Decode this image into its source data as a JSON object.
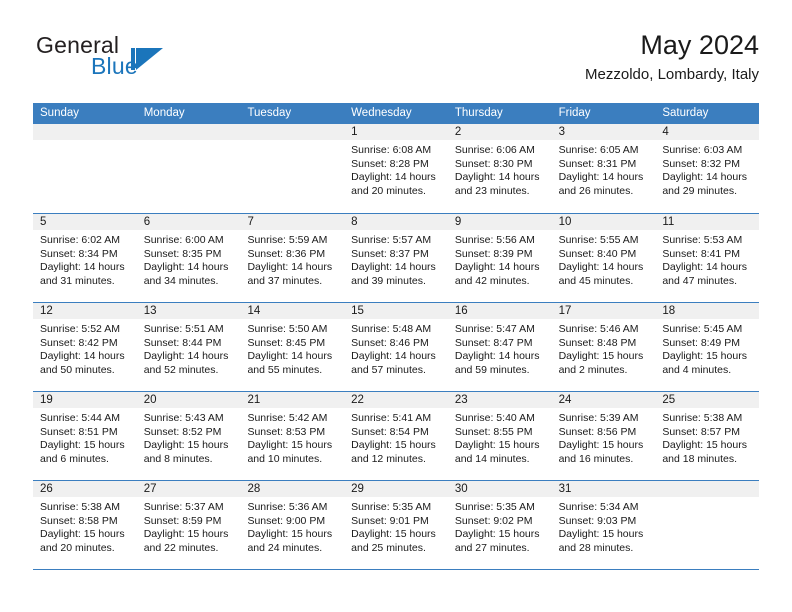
{
  "brand": {
    "name_part1": "General",
    "name_part2": "Blue",
    "accent_color": "#1b75bb"
  },
  "header": {
    "title": "May 2024",
    "subtitle": "Mezzoldo, Lombardy, Italy"
  },
  "calendar": {
    "header_color": "#3b7ebf",
    "weekday_headers": [
      "Sunday",
      "Monday",
      "Tuesday",
      "Wednesday",
      "Thursday",
      "Friday",
      "Saturday"
    ],
    "weeks": [
      [
        {
          "day": "",
          "sunrise": "",
          "sunset": "",
          "daylight_line1": "",
          "daylight_line2": ""
        },
        {
          "day": "",
          "sunrise": "",
          "sunset": "",
          "daylight_line1": "",
          "daylight_line2": ""
        },
        {
          "day": "",
          "sunrise": "",
          "sunset": "",
          "daylight_line1": "",
          "daylight_line2": ""
        },
        {
          "day": "1",
          "sunrise": "Sunrise: 6:08 AM",
          "sunset": "Sunset: 8:28 PM",
          "daylight_line1": "Daylight: 14 hours",
          "daylight_line2": "and 20 minutes."
        },
        {
          "day": "2",
          "sunrise": "Sunrise: 6:06 AM",
          "sunset": "Sunset: 8:30 PM",
          "daylight_line1": "Daylight: 14 hours",
          "daylight_line2": "and 23 minutes."
        },
        {
          "day": "3",
          "sunrise": "Sunrise: 6:05 AM",
          "sunset": "Sunset: 8:31 PM",
          "daylight_line1": "Daylight: 14 hours",
          "daylight_line2": "and 26 minutes."
        },
        {
          "day": "4",
          "sunrise": "Sunrise: 6:03 AM",
          "sunset": "Sunset: 8:32 PM",
          "daylight_line1": "Daylight: 14 hours",
          "daylight_line2": "and 29 minutes."
        }
      ],
      [
        {
          "day": "5",
          "sunrise": "Sunrise: 6:02 AM",
          "sunset": "Sunset: 8:34 PM",
          "daylight_line1": "Daylight: 14 hours",
          "daylight_line2": "and 31 minutes."
        },
        {
          "day": "6",
          "sunrise": "Sunrise: 6:00 AM",
          "sunset": "Sunset: 8:35 PM",
          "daylight_line1": "Daylight: 14 hours",
          "daylight_line2": "and 34 minutes."
        },
        {
          "day": "7",
          "sunrise": "Sunrise: 5:59 AM",
          "sunset": "Sunset: 8:36 PM",
          "daylight_line1": "Daylight: 14 hours",
          "daylight_line2": "and 37 minutes."
        },
        {
          "day": "8",
          "sunrise": "Sunrise: 5:57 AM",
          "sunset": "Sunset: 8:37 PM",
          "daylight_line1": "Daylight: 14 hours",
          "daylight_line2": "and 39 minutes."
        },
        {
          "day": "9",
          "sunrise": "Sunrise: 5:56 AM",
          "sunset": "Sunset: 8:39 PM",
          "daylight_line1": "Daylight: 14 hours",
          "daylight_line2": "and 42 minutes."
        },
        {
          "day": "10",
          "sunrise": "Sunrise: 5:55 AM",
          "sunset": "Sunset: 8:40 PM",
          "daylight_line1": "Daylight: 14 hours",
          "daylight_line2": "and 45 minutes."
        },
        {
          "day": "11",
          "sunrise": "Sunrise: 5:53 AM",
          "sunset": "Sunset: 8:41 PM",
          "daylight_line1": "Daylight: 14 hours",
          "daylight_line2": "and 47 minutes."
        }
      ],
      [
        {
          "day": "12",
          "sunrise": "Sunrise: 5:52 AM",
          "sunset": "Sunset: 8:42 PM",
          "daylight_line1": "Daylight: 14 hours",
          "daylight_line2": "and 50 minutes."
        },
        {
          "day": "13",
          "sunrise": "Sunrise: 5:51 AM",
          "sunset": "Sunset: 8:44 PM",
          "daylight_line1": "Daylight: 14 hours",
          "daylight_line2": "and 52 minutes."
        },
        {
          "day": "14",
          "sunrise": "Sunrise: 5:50 AM",
          "sunset": "Sunset: 8:45 PM",
          "daylight_line1": "Daylight: 14 hours",
          "daylight_line2": "and 55 minutes."
        },
        {
          "day": "15",
          "sunrise": "Sunrise: 5:48 AM",
          "sunset": "Sunset: 8:46 PM",
          "daylight_line1": "Daylight: 14 hours",
          "daylight_line2": "and 57 minutes."
        },
        {
          "day": "16",
          "sunrise": "Sunrise: 5:47 AM",
          "sunset": "Sunset: 8:47 PM",
          "daylight_line1": "Daylight: 14 hours",
          "daylight_line2": "and 59 minutes."
        },
        {
          "day": "17",
          "sunrise": "Sunrise: 5:46 AM",
          "sunset": "Sunset: 8:48 PM",
          "daylight_line1": "Daylight: 15 hours",
          "daylight_line2": "and 2 minutes."
        },
        {
          "day": "18",
          "sunrise": "Sunrise: 5:45 AM",
          "sunset": "Sunset: 8:49 PM",
          "daylight_line1": "Daylight: 15 hours",
          "daylight_line2": "and 4 minutes."
        }
      ],
      [
        {
          "day": "19",
          "sunrise": "Sunrise: 5:44 AM",
          "sunset": "Sunset: 8:51 PM",
          "daylight_line1": "Daylight: 15 hours",
          "daylight_line2": "and 6 minutes."
        },
        {
          "day": "20",
          "sunrise": "Sunrise: 5:43 AM",
          "sunset": "Sunset: 8:52 PM",
          "daylight_line1": "Daylight: 15 hours",
          "daylight_line2": "and 8 minutes."
        },
        {
          "day": "21",
          "sunrise": "Sunrise: 5:42 AM",
          "sunset": "Sunset: 8:53 PM",
          "daylight_line1": "Daylight: 15 hours",
          "daylight_line2": "and 10 minutes."
        },
        {
          "day": "22",
          "sunrise": "Sunrise: 5:41 AM",
          "sunset": "Sunset: 8:54 PM",
          "daylight_line1": "Daylight: 15 hours",
          "daylight_line2": "and 12 minutes."
        },
        {
          "day": "23",
          "sunrise": "Sunrise: 5:40 AM",
          "sunset": "Sunset: 8:55 PM",
          "daylight_line1": "Daylight: 15 hours",
          "daylight_line2": "and 14 minutes."
        },
        {
          "day": "24",
          "sunrise": "Sunrise: 5:39 AM",
          "sunset": "Sunset: 8:56 PM",
          "daylight_line1": "Daylight: 15 hours",
          "daylight_line2": "and 16 minutes."
        },
        {
          "day": "25",
          "sunrise": "Sunrise: 5:38 AM",
          "sunset": "Sunset: 8:57 PM",
          "daylight_line1": "Daylight: 15 hours",
          "daylight_line2": "and 18 minutes."
        }
      ],
      [
        {
          "day": "26",
          "sunrise": "Sunrise: 5:38 AM",
          "sunset": "Sunset: 8:58 PM",
          "daylight_line1": "Daylight: 15 hours",
          "daylight_line2": "and 20 minutes."
        },
        {
          "day": "27",
          "sunrise": "Sunrise: 5:37 AM",
          "sunset": "Sunset: 8:59 PM",
          "daylight_line1": "Daylight: 15 hours",
          "daylight_line2": "and 22 minutes."
        },
        {
          "day": "28",
          "sunrise": "Sunrise: 5:36 AM",
          "sunset": "Sunset: 9:00 PM",
          "daylight_line1": "Daylight: 15 hours",
          "daylight_line2": "and 24 minutes."
        },
        {
          "day": "29",
          "sunrise": "Sunrise: 5:35 AM",
          "sunset": "Sunset: 9:01 PM",
          "daylight_line1": "Daylight: 15 hours",
          "daylight_line2": "and 25 minutes."
        },
        {
          "day": "30",
          "sunrise": "Sunrise: 5:35 AM",
          "sunset": "Sunset: 9:02 PM",
          "daylight_line1": "Daylight: 15 hours",
          "daylight_line2": "and 27 minutes."
        },
        {
          "day": "31",
          "sunrise": "Sunrise: 5:34 AM",
          "sunset": "Sunset: 9:03 PM",
          "daylight_line1": "Daylight: 15 hours",
          "daylight_line2": "and 28 minutes."
        },
        {
          "day": "",
          "sunrise": "",
          "sunset": "",
          "daylight_line1": "",
          "daylight_line2": ""
        }
      ]
    ]
  }
}
